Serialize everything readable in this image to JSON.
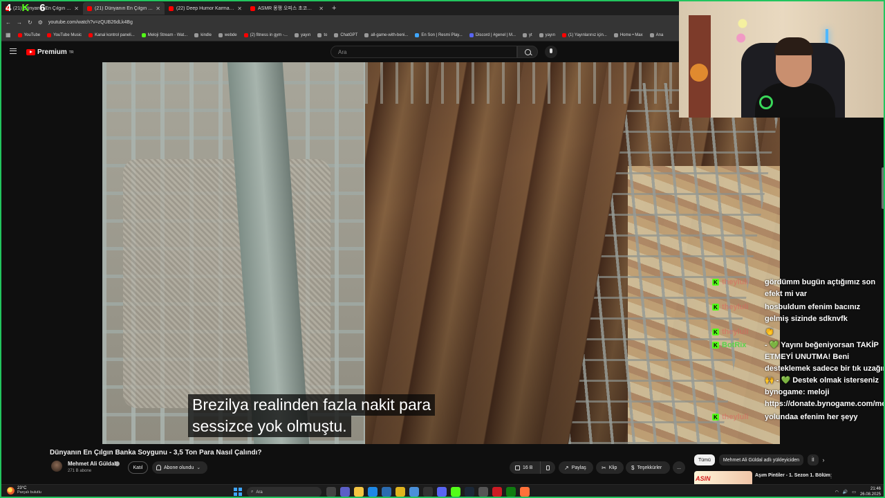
{
  "browser": {
    "counter_overlay": [
      "4",
      "K",
      "6"
    ],
    "tabs": [
      {
        "title": "(21) Dünyanın En Çılgın Banka...",
        "color": "#ff0000",
        "active": false
      },
      {
        "title": "(21) Dünyanın En Çılgın Banka",
        "color": "#ff0000",
        "active": true
      },
      {
        "title": "(22) Deep Humor Karma Röportaj",
        "color": "#ff0000",
        "active": false
      },
      {
        "title": "ASMR 몽쟁 오피스 초코파이 ...",
        "color": "#ff0000",
        "active": false
      }
    ],
    "new_tab_label": "+",
    "url": "youtube.com/watch?v=zQUB26dLk4Bg",
    "bookmarks": [
      "YouTube",
      "YouTube Music",
      "Kanal kontrol paneli...",
      "Meloji Stream - Wat...",
      "kindle",
      "webde",
      "(2) fitness in gym -...",
      "yayın",
      "to",
      "ChatGPT",
      "all-game-with-beni...",
      "En Son | Resmi Play...",
      "Discord | #genel | M...",
      "yt",
      "yayın",
      "(1) Yayınlarınız için...",
      "Home • Max",
      "Ana"
    ]
  },
  "youtube": {
    "logo_text": "Premium",
    "logo_region": "TR",
    "search_placeholder": "Ara",
    "brand_color": "#ff0000"
  },
  "video": {
    "subtitle_line1": "Brezilya realinden fazla nakit para",
    "subtitle_line2": "sessizce yok olmuştu.",
    "title": "Dünyanın En Çılgın Banka Soygunu - 3,5 Ton Para Nasıl Çalındı?",
    "channel_name": "Mehmet Ali Güldal",
    "subscribers": "271 B abone",
    "join_label": "Katıl",
    "subscribed_label": "Abone olundu",
    "like_count": "16 B",
    "share_label": "Paylaş",
    "clip_label": "Klip",
    "thanks_label": "Teşekkürler",
    "more_label": "..."
  },
  "chat": [
    {
      "user": "theyluli",
      "text": "gördümm bugün açtığımız son efekt mi var",
      "user_color": "#e35b5b"
    },
    {
      "user": "theyluli",
      "text": "hosbuldum efenim bacınız gelmiş sizinde sdknvfk",
      "user_color": "#e35b5b"
    },
    {
      "user": "theyluli",
      "text": "👏",
      "user_color": "#e35b5b"
    },
    {
      "user": "BotRix",
      "text": "- 💚 Yayını beğeniyorsan TAKİP ETMEYİ UNUTMA! Beni desteklemek sadece bir tık uzağında 🙌 - 💚 Destek olmak isterseniz bynogame: meloji https://donate.bynogame.com/meloji",
      "user_color": "#5bd34b"
    },
    {
      "user": "theyluli",
      "text": "yolundaa efenim her şeyy",
      "user_color": "#e35b5b"
    }
  ],
  "sidebar": {
    "chips": [
      "Tümü",
      "Mehmet Ali Güldal adlı yükleyiciden",
      "İl"
    ],
    "next_chip": "›",
    "recommendation_title": "Aşım Pintiler - 1. Sezon 1. Bölüm",
    "recommendation_more": "⋮"
  },
  "taskbar": {
    "temperature": "23°C",
    "weather_text": "Parçalı bulutlu",
    "search_label": "Ara",
    "time": "21:46",
    "date": "26.08.2025"
  }
}
